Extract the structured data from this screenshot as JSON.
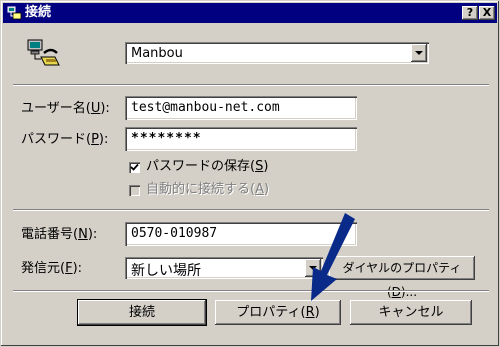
{
  "window": {
    "title": "接続",
    "help_button": "?",
    "close_button": "X"
  },
  "connection": {
    "selected": "Manbou"
  },
  "form": {
    "username_label": "ユーザー名(",
    "username_key": "U",
    "username_value": "test@manbou-net.com",
    "password_label": "パスワード(",
    "password_key": "P",
    "password_value": "********",
    "save_password_label": "パスワードの保存(",
    "save_password_key": "S",
    "save_password_checked": true,
    "auto_connect_label": "自動的に接続する(",
    "auto_connect_key": "A",
    "auto_connect_checked": false,
    "phone_label": "電話番号(",
    "phone_key": "N",
    "phone_value": "0570-010987",
    "dial_from_label": "発信元(",
    "dial_from_key": "F",
    "dial_from_value": "新しい場所",
    "dial_props_label": "ダイヤルのプロパティ(",
    "dial_props_key": "D"
  },
  "buttons": {
    "connect": "接続",
    "properties_label": "プロパティ(",
    "properties_key": "R",
    "cancel": "キャンセル"
  },
  "colors": {
    "titlebar": "#000080",
    "face": "#d4d0c8",
    "annotation_arrow": "#0a2a8a"
  }
}
